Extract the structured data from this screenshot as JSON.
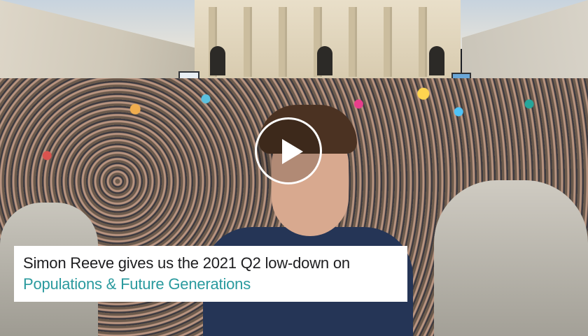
{
  "video": {
    "caption_line1": "Simon Reeve gives us the 2021 Q2 low-down on",
    "caption_line2": "Populations & Future Generations",
    "play_icon": "play-icon",
    "accent_color": "#2a9a9e",
    "caption_text_color": "#1d1d1f"
  }
}
